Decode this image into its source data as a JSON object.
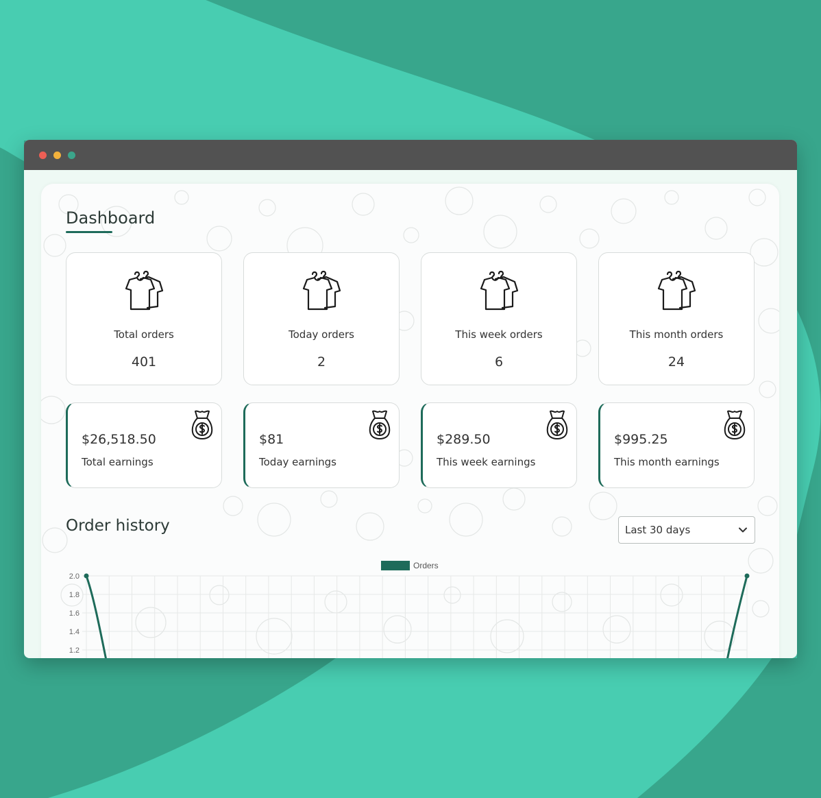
{
  "dashboard": {
    "title": "Dashboard",
    "order_cards": [
      {
        "label": "Total orders",
        "value": "401"
      },
      {
        "label": "Today orders",
        "value": "2"
      },
      {
        "label": "This week orders",
        "value": "6"
      },
      {
        "label": "This month orders",
        "value": "24"
      }
    ],
    "earning_cards": [
      {
        "amount": "$26,518.50",
        "label": "Total earnings"
      },
      {
        "amount": "$81",
        "label": "Today earnings"
      },
      {
        "amount": "$289.50",
        "label": "This week earnings"
      },
      {
        "amount": "$995.25",
        "label": "This month earnings"
      }
    ]
  },
  "order_history": {
    "title": "Order history",
    "range_select": {
      "value": "Last 30 days"
    }
  },
  "colors": {
    "accent": "#1e6b5a",
    "background": "#38a68c",
    "background_light": "#48cdb1"
  },
  "icons": {
    "order_card": "t-shirt-hanger-icon",
    "earning_card": "money-bag-icon",
    "select": "chevron-down-icon"
  },
  "chart_data": {
    "type": "line",
    "series": [
      {
        "name": "Orders",
        "color": "#1e6b5a"
      }
    ],
    "y_ticks": [
      "2.0",
      "1.8",
      "1.6",
      "1.4",
      "1.2"
    ],
    "grid": true,
    "legend": "top-center"
  }
}
